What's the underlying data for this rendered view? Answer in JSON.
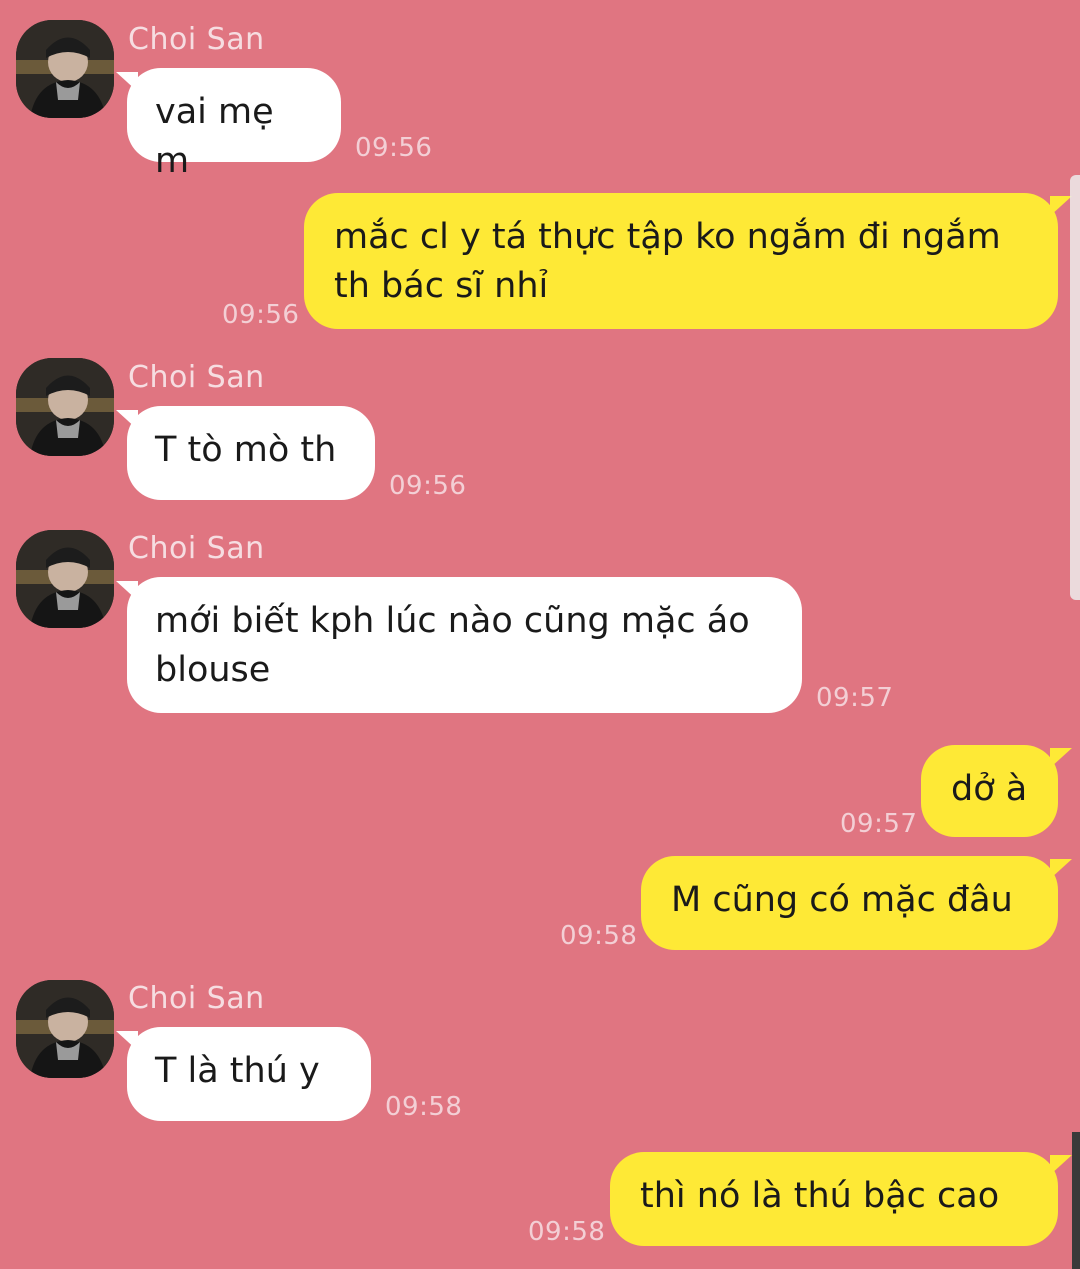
{
  "contact": {
    "name": "Choi San",
    "avatar_icon": "person-avatar-photo"
  },
  "colors": {
    "background": "#e07581",
    "incoming_bubble": "#ffffff",
    "outgoing_bubble": "#fee936"
  },
  "messages": [
    {
      "direction": "in",
      "show_sender": true,
      "text": "vai mẹ m",
      "time": "09:56"
    },
    {
      "direction": "out",
      "text": "mắc cl y tá thực tập ko ngắm đi ngắm\nth bác sĩ nhỉ",
      "time": "09:56"
    },
    {
      "direction": "in",
      "show_sender": true,
      "text": "T tò mò th",
      "time": "09:56"
    },
    {
      "direction": "in",
      "show_sender": true,
      "text": "mới biết kph lúc nào cũng mặc áo\nblouse",
      "time": "09:57"
    },
    {
      "direction": "out",
      "text": "dở à",
      "time": "09:57"
    },
    {
      "direction": "out",
      "text": "M cũng có mặc đâu",
      "time": "09:58"
    },
    {
      "direction": "in",
      "show_sender": true,
      "text": "T là thú y",
      "time": "09:58"
    },
    {
      "direction": "out",
      "text": "thì nó là thú bậc cao",
      "time": "09:58"
    }
  ]
}
